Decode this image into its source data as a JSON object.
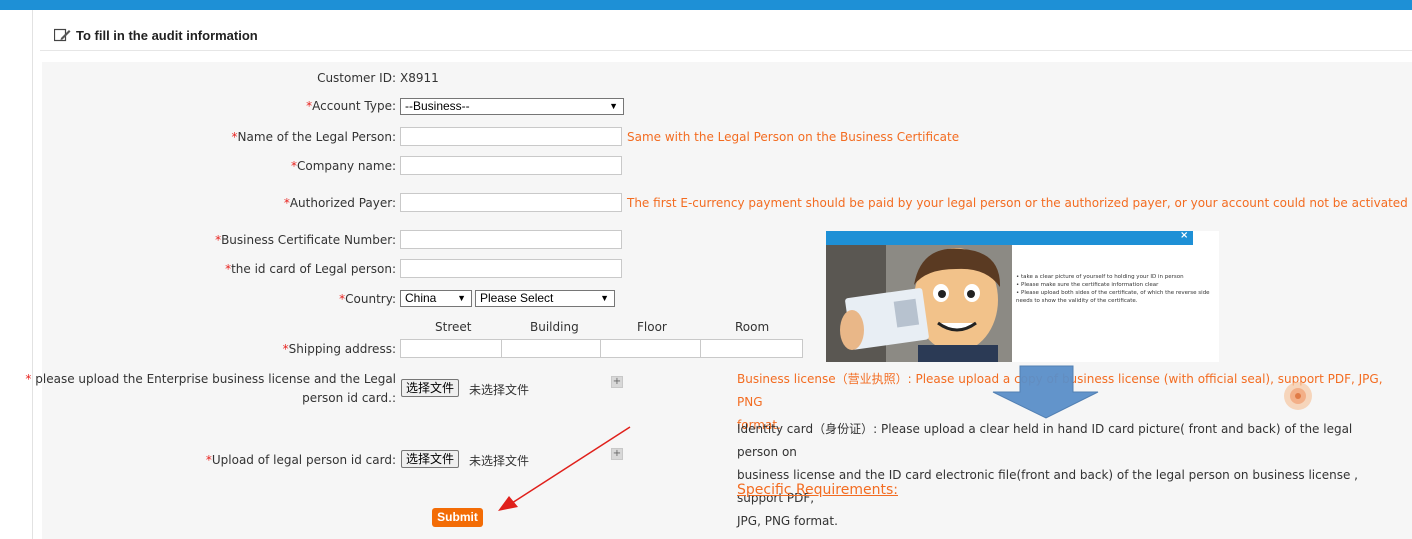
{
  "header": {
    "title": "To fill in the audit information"
  },
  "form": {
    "customer_id_label": "Customer ID:",
    "customer_id_value": "X8911",
    "account_type_label": "Account Type:",
    "account_type_value": "--Business--",
    "legal_person_label": "Name of the Legal Person:",
    "legal_person_hint": "Same with the Legal Person on the Business Certificate",
    "company_name_label": "Company name:",
    "authorized_payer_label": "Authorized Payer:",
    "authorized_payer_hint": "The first E-currency payment should be paid by your legal person or the authorized payer, or your account could not be activated",
    "business_cert_label": "Business Certificate Number:",
    "id_card_label": "the id card of Legal person:",
    "country_label": "Country:",
    "country_value": "China",
    "province_value": "Please Select",
    "address_columns": [
      "Street",
      "Building",
      "Floor",
      "Room"
    ],
    "shipping_label": "Shipping address:",
    "upload_license_label_line1": "please upload the Enterprise business license and the Legal",
    "upload_license_label_line2": "person id card.:",
    "upload_idcard_label": "Upload of legal person id card:",
    "file_button": "选择文件",
    "file_none": "未选择文件",
    "plus_symbol": "+",
    "required_mark": "*",
    "submit_label": "Submit"
  },
  "info": {
    "license_line1": "Business license（营业执照）: Please upload a copy of business license (with official seal), support PDF, JPG, PNG",
    "license_line2": "format.",
    "id_line1": "Identity card（身份证）: Please upload a clear held in hand ID card picture( front and back) of the legal person on",
    "id_line2": "business license and the ID card electronic file(front and back) of the legal person on business license , support PDF,",
    "id_line3": "JPG, PNG format.",
    "link": "Specific Requirements:"
  },
  "popup": {
    "close": "×",
    "tips": [
      "take a clear picture of yourself to holding your ID in person",
      "Please make sure the certificate information clear",
      "Please upload both sides of the certificate, of which the reverse side needs to show the validity of the certificate."
    ]
  },
  "colors": {
    "accent": "#1e90d6",
    "orange": "#f36c21",
    "submit": "#f36c06",
    "required": "#e8231f"
  }
}
